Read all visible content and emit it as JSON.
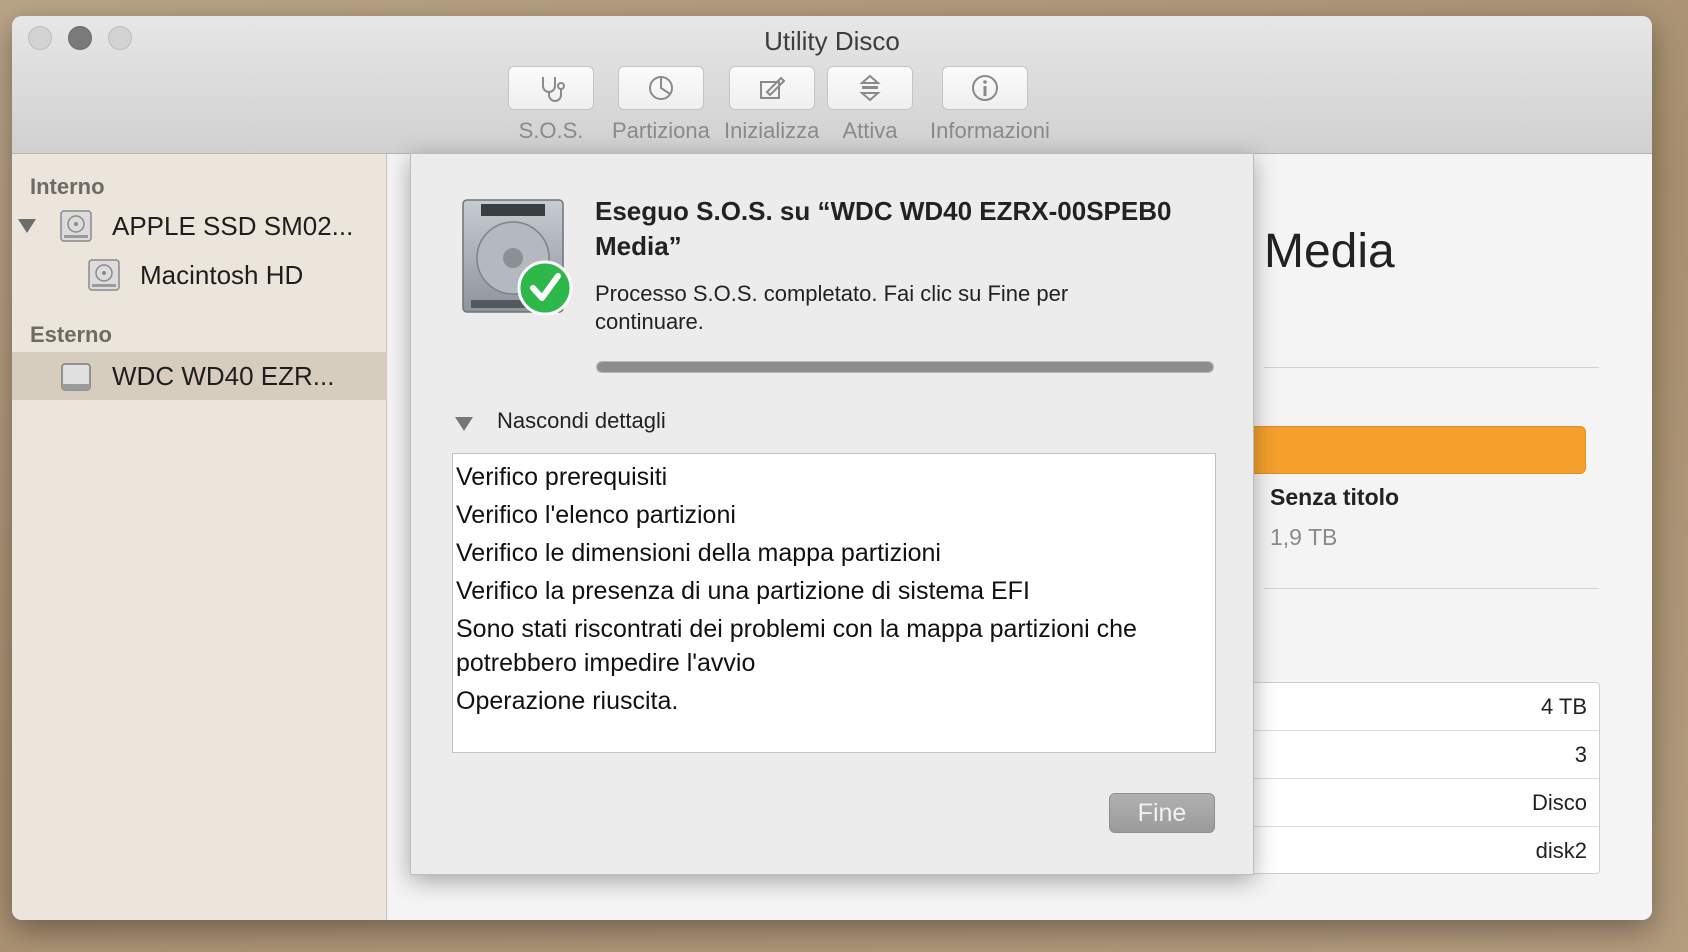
{
  "window": {
    "title": "Utility Disco"
  },
  "toolbar": [
    {
      "label": "S.O.S.",
      "icon": "stethoscope-icon"
    },
    {
      "label": "Partiziona",
      "icon": "pie-chart-icon"
    },
    {
      "label": "Inizializza",
      "icon": "erase-icon"
    },
    {
      "label": "Attiva",
      "icon": "mount-icon"
    },
    {
      "label": "Informazioni",
      "icon": "info-icon"
    }
  ],
  "sidebar": {
    "internal_header": "Interno",
    "external_header": "Esterno",
    "items": [
      {
        "label": "APPLE SSD SM02...",
        "icon": "internal-drive-icon"
      },
      {
        "label": "Macintosh HD",
        "icon": "volume-icon"
      },
      {
        "label": "WDC WD40 EZR...",
        "icon": "external-drive-icon",
        "selected": true
      }
    ]
  },
  "main": {
    "title_partial": "Media",
    "volume_name": "Senza titolo",
    "volume_size": "1,9 TB",
    "info_values": [
      "4 TB",
      "3",
      "Disco",
      "disk2"
    ],
    "bar_color": "#f5a02d"
  },
  "sheet": {
    "title": "Eseguo S.O.S. su “WDC WD40 EZRX-00SPEB0 Media”",
    "message": "Processo S.O.S. completato. Fai clic su Fine per continuare.",
    "progress": 1.0,
    "details_toggle": "Nascondi dettagli",
    "log": [
      "Verifico prerequisiti",
      "Verifico l'elenco partizioni",
      "Verifico le dimensioni della mappa partizioni",
      "Verifico la presenza di una partizione di sistema EFI",
      "Sono stati riscontrati dei problemi con la mappa partizioni che potrebbero impedire l'avvio",
      "Operazione riuscita."
    ],
    "done_label": "Fine"
  }
}
